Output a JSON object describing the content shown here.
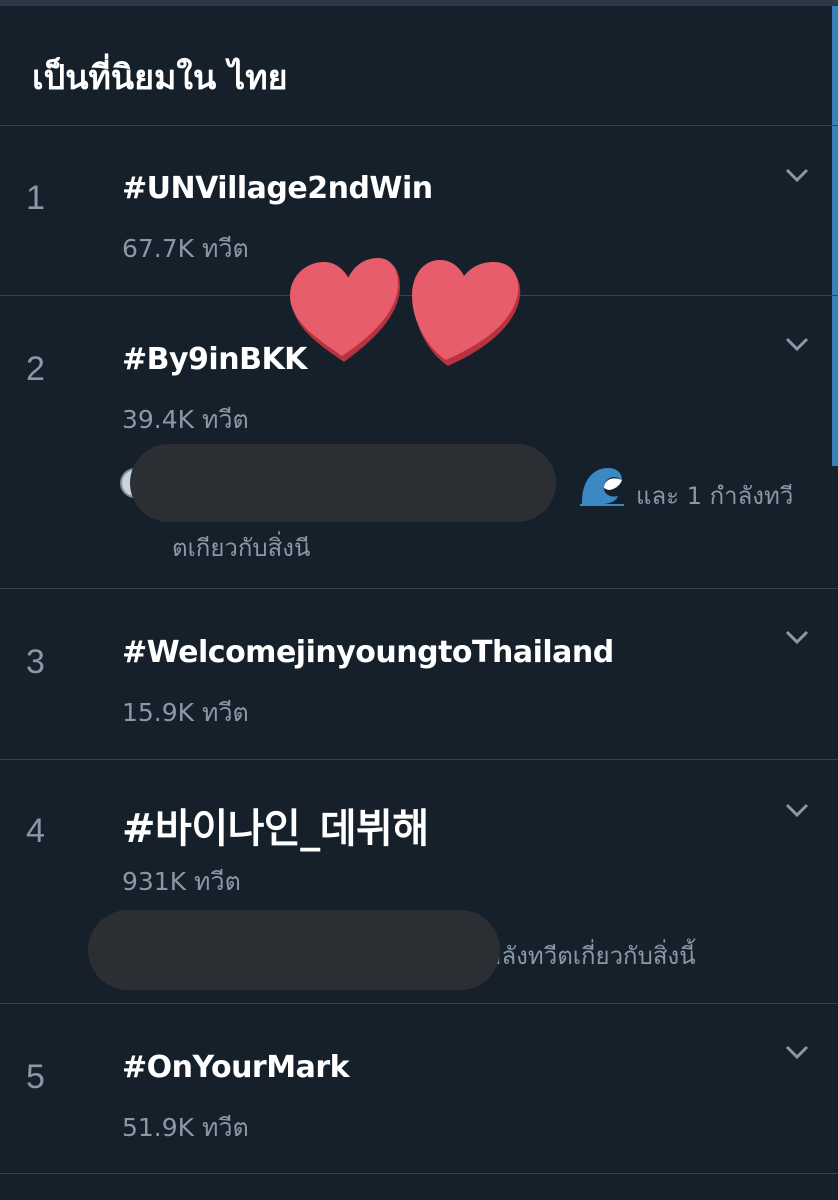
{
  "header": {
    "title": "เป็นที่นิยมใน ไทย"
  },
  "trends": [
    {
      "rank": "1",
      "tag": "#UNVillage2ndWin",
      "count": "67.7K ทวีต"
    },
    {
      "rank": "2",
      "tag": "#By9inBKK",
      "count": "39.4K ทวีต",
      "context_line1": "และ 1 กำลังทวี",
      "context_line2": "ตเกียวกับสิ่งนี"
    },
    {
      "rank": "3",
      "tag": "#WelcomejinyoungtoThailand",
      "count": "15.9K ทวีต"
    },
    {
      "rank": "4",
      "tag": "#바이나인_데뷔해",
      "count": "931K ทวีต",
      "context_line1": "าลังทวีตเกี่ยวกับสิ่งนี้"
    },
    {
      "rank": "5",
      "tag": "#OnYourMark",
      "count": "51.9K ทวีต"
    }
  ],
  "icons": {
    "chevron": "chevron-down-icon",
    "wave": "water-wave-emoji-icon",
    "hearts": "red-heart-stickers"
  },
  "colors": {
    "background": "#15202b",
    "divider": "#38444d",
    "secondary_text": "#8899a6",
    "heart": "#e85d6c"
  }
}
